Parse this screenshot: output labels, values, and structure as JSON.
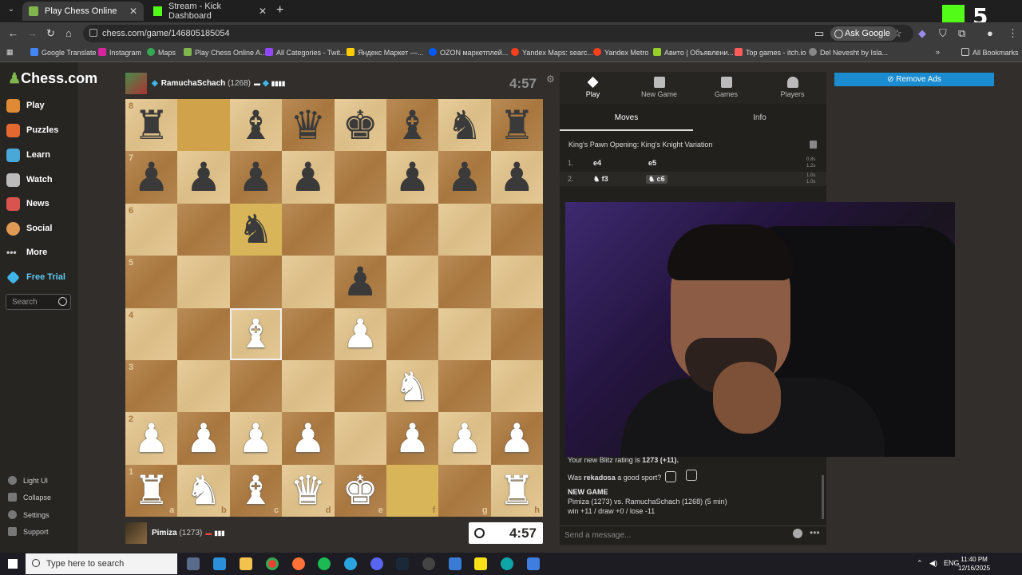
{
  "browser": {
    "tabs": [
      {
        "title": "Play Chess Online for FREE",
        "active": true
      },
      {
        "title": "Stream - Kick Dashboard",
        "active": false
      }
    ],
    "url": "chess.com/game/146805185054",
    "ask_google": "Ask Google",
    "kick_number": "5",
    "bookmarks": [
      "Google Translate",
      "Instagram",
      "Maps",
      "Play Chess Online A...",
      "All Categories - Twit...",
      "Яндекс Маркет —...",
      "OZON маркетплей...",
      "Yandex Maps: searc...",
      "Yandex Metro",
      "Авито | Объявлени...",
      "Top games - itch.io",
      "Del Nevesht by Isla..."
    ],
    "all_bookmarks": "All Bookmarks"
  },
  "sidebar": {
    "logo": "Chess.com",
    "items": [
      "Play",
      "Puzzles",
      "Learn",
      "Watch",
      "News",
      "Social",
      "More",
      "Free Trial"
    ],
    "search_placeholder": "Search",
    "bottom": [
      "Light UI",
      "Collapse",
      "Settings",
      "Support"
    ]
  },
  "top_player": {
    "name": "RamuchaSchach",
    "rating": "(1268)",
    "clock": "4:57"
  },
  "bottom_player": {
    "name": "Pimiza",
    "rating": "(1273)",
    "clock": "4:57"
  },
  "board": {
    "rows": [
      [
        "bR",
        "",
        "bB",
        "bQ",
        "bK",
        "bB",
        "bN",
        "bR"
      ],
      [
        "bP",
        "bP",
        "bP",
        "bP",
        "",
        "bP",
        "bP",
        "bP"
      ],
      [
        "",
        "",
        "bN",
        "",
        "",
        "",
        "",
        ""
      ],
      [
        "",
        "",
        "",
        "",
        "bP",
        "",
        "",
        ""
      ],
      [
        "",
        "",
        "wB",
        "",
        "wP",
        "",
        "",
        ""
      ],
      [
        "",
        "",
        "",
        "",
        "",
        "wN",
        "",
        ""
      ],
      [
        "wP",
        "wP",
        "wP",
        "wP",
        "",
        "wP",
        "wP",
        "wP"
      ],
      [
        "wR",
        "wN",
        "wB",
        "wQ",
        "wK",
        "",
        "",
        "wR"
      ]
    ],
    "ranks": [
      "8",
      "7",
      "6",
      "5",
      "4",
      "3",
      "2",
      "1"
    ],
    "files": [
      "a",
      "b",
      "c",
      "d",
      "e",
      "f",
      "g",
      "h"
    ]
  },
  "panel": {
    "tabs": [
      "Play",
      "New Game",
      "Games",
      "Players"
    ],
    "subtabs": [
      "Moves",
      "Info"
    ],
    "opening": "King's Pawn Opening: King's Knight Variation",
    "moves": [
      {
        "num": "1.",
        "white": "e4",
        "black": "e5",
        "t1": "0.8s",
        "t2": "1.2s"
      },
      {
        "num": "2.",
        "white": "♞ f3",
        "black": "♞ c6",
        "t1": "1.0s",
        "t2": "1.0s"
      }
    ]
  },
  "remove_ads": "Remove Ads",
  "chat": {
    "rating_line_prefix": "Your new Blitz rating is ",
    "rating_value": "1273 (+11).",
    "sport_prefix": "Was ",
    "sport_user": "rekadosa",
    "sport_suffix": " a good sport?",
    "new_game": "NEW GAME",
    "match_line": "Pimiza (1273) vs. RamuchaSchach (1268) (5 min)",
    "result_line": "win +11 / draw +0 / lose -11",
    "placeholder": "Send a message..."
  },
  "taskbar": {
    "search_placeholder": "Type here to search",
    "lang": "ENG",
    "time": "11:40 PM",
    "date": "12/16/2025"
  }
}
